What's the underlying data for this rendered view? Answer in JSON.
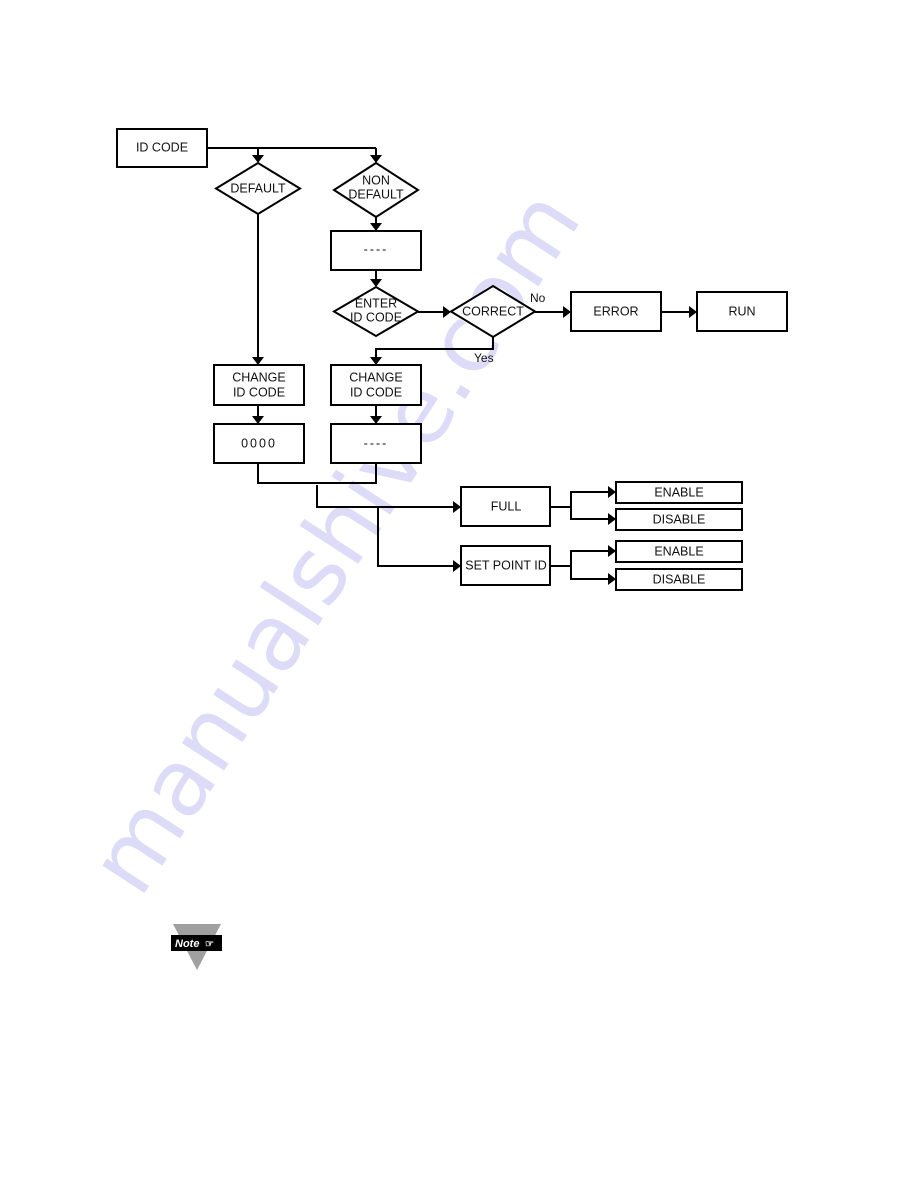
{
  "watermark": "manualshive.com",
  "nodes": {
    "id_code": "ID CODE",
    "default": "DEFAULT",
    "non_default": [
      "NON",
      "DEFAULT"
    ],
    "blank_display_1": "----",
    "enter_id_code": [
      "ENTER",
      "ID CODE"
    ],
    "correct": "CORRECT",
    "error": "ERROR",
    "run": "RUN",
    "change_id_code_left": [
      "CHANGE",
      "ID CODE"
    ],
    "change_id_code_right": [
      "CHANGE",
      "ID CODE"
    ],
    "zero_display": "0000",
    "blank_display_2": "----",
    "full": "FULL",
    "set_point_id": "SET POINT ID",
    "full_enable": "ENABLE",
    "full_disable": "DISABLE",
    "spid_enable": "ENABLE",
    "spid_disable": "DISABLE"
  },
  "edge_labels": {
    "no": "No",
    "yes": "Yes"
  },
  "note_icon": {
    "label": "Note",
    "glyph": "☞"
  },
  "colors": {
    "stroke": "#000000",
    "watermark": "#dcdcf8",
    "note_triangle": "#a0a0a0"
  }
}
